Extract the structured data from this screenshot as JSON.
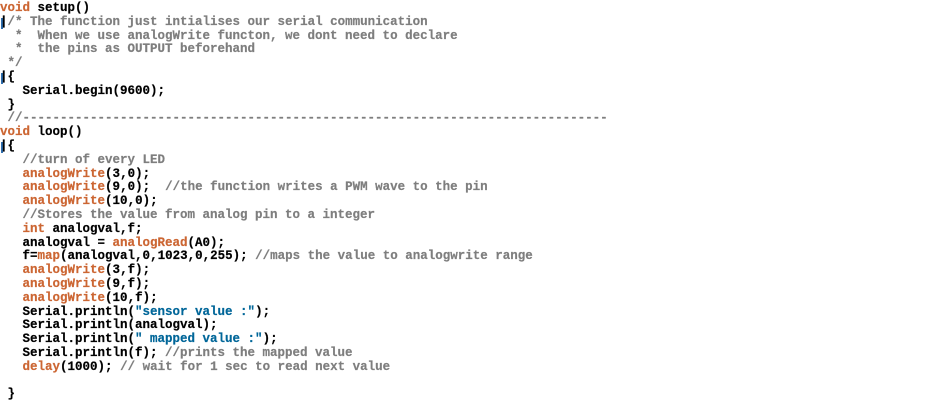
{
  "editor": {
    "colors": {
      "keyword": "#cc6633",
      "comment": "#7e7e7e",
      "number": "#000000",
      "string": "#006699",
      "plain": "#000000",
      "fold_marker": "#2f6fb0"
    },
    "lines": [
      [
        {
          "t": "type",
          "v": "void"
        },
        {
          "t": "plain",
          "v": " setup()"
        }
      ],
      [
        {
          "t": "plain",
          "v": "|"
        },
        {
          "t": "comment",
          "v": "/* The function just intialises our serial communication"
        }
      ],
      [
        {
          "t": "comment",
          "v": "  *  When we use analogWrite functon, we dont need to declare"
        }
      ],
      [
        {
          "t": "comment",
          "v": "  *  the pins as OUTPUT beforehand"
        }
      ],
      [
        {
          "t": "comment",
          "v": " */"
        }
      ],
      [
        {
          "t": "plain",
          "v": "|{"
        }
      ],
      [
        {
          "t": "plain",
          "v": "   Serial.begin("
        },
        {
          "t": "num",
          "v": "9600"
        },
        {
          "t": "plain",
          "v": ");"
        }
      ],
      [
        {
          "t": "plain",
          "v": " }"
        }
      ],
      [
        {
          "t": "comment",
          "v": " //------------------------------------------------------------------------------"
        }
      ],
      [
        {
          "t": "type",
          "v": "void"
        },
        {
          "t": "plain",
          "v": " loop()"
        }
      ],
      [
        {
          "t": "plain",
          "v": "|{"
        }
      ],
      [
        {
          "t": "comment",
          "v": "   //turn of every LED"
        }
      ],
      [
        {
          "t": "fn",
          "v": "   analogWrite"
        },
        {
          "t": "plain",
          "v": "("
        },
        {
          "t": "num",
          "v": "3"
        },
        {
          "t": "plain",
          "v": ","
        },
        {
          "t": "num",
          "v": "0"
        },
        {
          "t": "plain",
          "v": ");"
        }
      ],
      [
        {
          "t": "fn",
          "v": "   analogWrite"
        },
        {
          "t": "plain",
          "v": "("
        },
        {
          "t": "num",
          "v": "9"
        },
        {
          "t": "plain",
          "v": ","
        },
        {
          "t": "num",
          "v": "0"
        },
        {
          "t": "plain",
          "v": ");  "
        },
        {
          "t": "comment",
          "v": "//the function writes a PWM wave to the pin"
        }
      ],
      [
        {
          "t": "fn",
          "v": "   analogWrite"
        },
        {
          "t": "plain",
          "v": "("
        },
        {
          "t": "num",
          "v": "10"
        },
        {
          "t": "plain",
          "v": ","
        },
        {
          "t": "num",
          "v": "0"
        },
        {
          "t": "plain",
          "v": ");"
        }
      ],
      [
        {
          "t": "comment",
          "v": "   //Stores the value from analog pin to a integer"
        }
      ],
      [
        {
          "t": "type",
          "v": "   int"
        },
        {
          "t": "plain",
          "v": " analogval,f;"
        }
      ],
      [
        {
          "t": "plain",
          "v": "   analogval = "
        },
        {
          "t": "fn",
          "v": "analogRead"
        },
        {
          "t": "plain",
          "v": "(A0);"
        }
      ],
      [
        {
          "t": "plain",
          "v": "   f="
        },
        {
          "t": "fn",
          "v": "map"
        },
        {
          "t": "plain",
          "v": "(analogval,"
        },
        {
          "t": "num",
          "v": "0"
        },
        {
          "t": "plain",
          "v": ","
        },
        {
          "t": "num",
          "v": "1023"
        },
        {
          "t": "plain",
          "v": ","
        },
        {
          "t": "num",
          "v": "0"
        },
        {
          "t": "plain",
          "v": ","
        },
        {
          "t": "num",
          "v": "255"
        },
        {
          "t": "plain",
          "v": "); "
        },
        {
          "t": "comment",
          "v": "//maps the value to analogwrite range"
        }
      ],
      [
        {
          "t": "fn",
          "v": "   analogWrite"
        },
        {
          "t": "plain",
          "v": "("
        },
        {
          "t": "num",
          "v": "3"
        },
        {
          "t": "plain",
          "v": ",f);"
        }
      ],
      [
        {
          "t": "fn",
          "v": "   analogWrite"
        },
        {
          "t": "plain",
          "v": "("
        },
        {
          "t": "num",
          "v": "9"
        },
        {
          "t": "plain",
          "v": ",f);"
        }
      ],
      [
        {
          "t": "fn",
          "v": "   analogWrite"
        },
        {
          "t": "plain",
          "v": "("
        },
        {
          "t": "num",
          "v": "10"
        },
        {
          "t": "plain",
          "v": ",f);"
        }
      ],
      [
        {
          "t": "plain",
          "v": "   Serial.println("
        },
        {
          "t": "str",
          "v": "\"sensor value :\""
        },
        {
          "t": "plain",
          "v": ");"
        }
      ],
      [
        {
          "t": "plain",
          "v": "   Serial.println(analogval);"
        }
      ],
      [
        {
          "t": "plain",
          "v": "   Serial.println("
        },
        {
          "t": "str",
          "v": "\" mapped value :\""
        },
        {
          "t": "plain",
          "v": ");"
        }
      ],
      [
        {
          "t": "plain",
          "v": "   Serial.println(f); "
        },
        {
          "t": "comment",
          "v": "//prints the mapped value"
        }
      ],
      [
        {
          "t": "fn",
          "v": "   delay"
        },
        {
          "t": "plain",
          "v": "("
        },
        {
          "t": "num",
          "v": "1000"
        },
        {
          "t": "plain",
          "v": "); "
        },
        {
          "t": "comment",
          "v": "// wait for 1 sec to read next value"
        }
      ],
      [
        {
          "t": "plain",
          "v": ""
        }
      ],
      [
        {
          "t": "plain",
          "v": " }"
        }
      ]
    ]
  }
}
